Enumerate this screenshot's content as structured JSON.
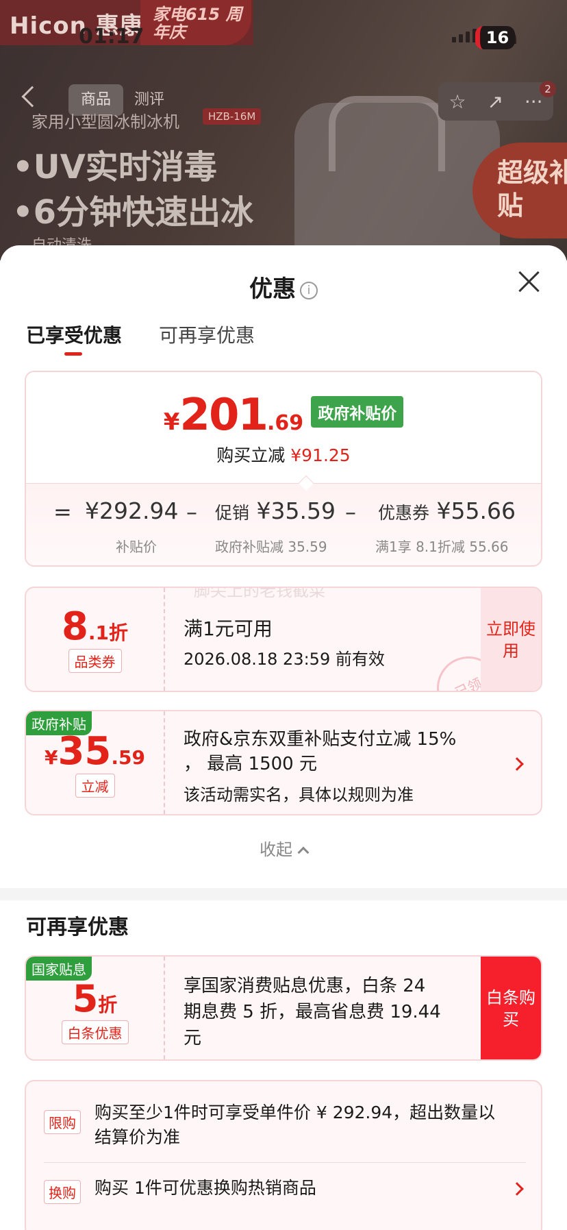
{
  "status_bar": {
    "time": "01:17",
    "battery": "16"
  },
  "background": {
    "brand_logo": "Hicon 惠康",
    "brand_promo": "家电615 周年庆",
    "tabs": [
      "商品",
      "测评"
    ],
    "subtitle": "家用小型圆冰制冰机",
    "model": "HZB-16M",
    "bullets": [
      "•UV实时消毒",
      "•6分钟快速出冰"
    ],
    "auto_clean": "自动清洗",
    "subsidy_badge": "超级补贴",
    "badge_count": "2"
  },
  "sheet": {
    "title": "优惠",
    "tabs": [
      "已享受优惠",
      "可再享优惠"
    ],
    "price": {
      "currency": "¥",
      "integer": "201",
      "decimal": ".69",
      "tag": "政府补贴价",
      "sub_label": "购买立减",
      "sub_value": "¥91.25"
    },
    "calc": {
      "eq": "=",
      "minus": "–",
      "base_value": "¥292.94",
      "base_label": "补贴价",
      "promo_label": "促销",
      "promo_value": "¥35.59",
      "promo_note": "政府补贴减 35.59",
      "coupon_label": "优惠券",
      "coupon_value": "¥55.66",
      "coupon_note": "满1享 8.1折减 55.66"
    },
    "coupon1": {
      "discount_int": "8",
      "discount_dec": ".1折",
      "tag": "品类券",
      "line1": "满1元可用",
      "line2": "2026.08.18 23:59 前有效",
      "action": "立即使用",
      "stamp": "已领",
      "watermark": "脚尖上的老钱截菜"
    },
    "coupon2": {
      "corner": "政府补贴",
      "currency": "¥",
      "int": "35",
      "dec": ".59",
      "tag": "立减",
      "line1": "政府&京东双重补贴支付立减 15%",
      "line1b": "， 最高 1500 元",
      "line2": "该活动需实名，具体以规则为准"
    },
    "collapse_label": "收起",
    "more_section": {
      "title": "可再享优惠",
      "coupon3": {
        "corner": "国家贴息",
        "discount_int": "5",
        "discount_dec": "折",
        "tag": "白条优惠",
        "line1": "享国家消费贴息优惠，白条 24",
        "line2": "期息费 5 折，最高省息费 19.44",
        "line3": "元",
        "action": "白条购买"
      },
      "rules": [
        {
          "tag": "限购",
          "text1": "购买至少1件时可享受单件价 ¥ 292.94，超出数量以",
          "text2": "结算价为准"
        },
        {
          "tag": "换购",
          "text1": "购买 1件可优惠换购热销商品"
        }
      ]
    }
  },
  "colors": {
    "accent": "#e2231a",
    "green": "#3ea44c"
  }
}
